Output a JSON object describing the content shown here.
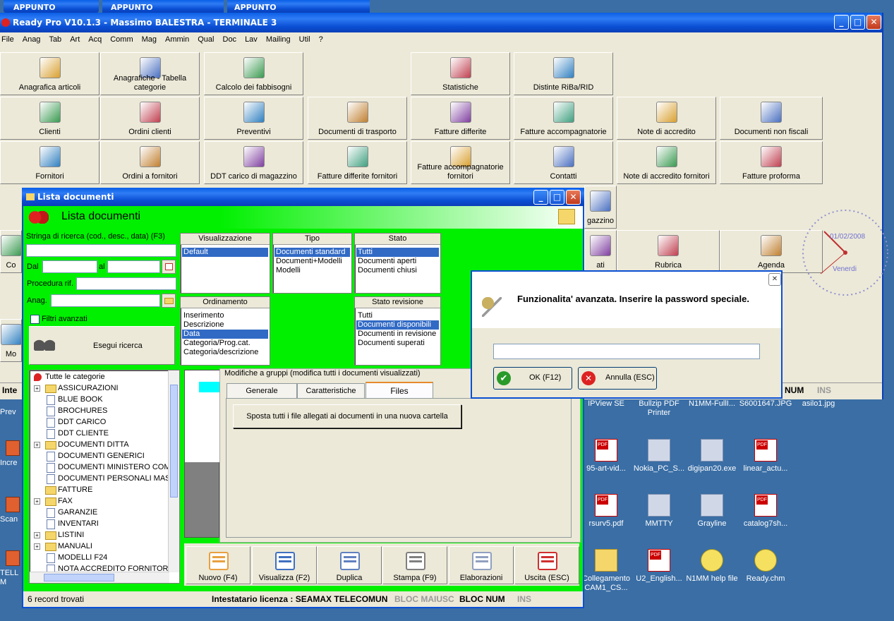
{
  "taskbar": {
    "tabs": [
      "APPUNTO",
      "APPUNTO",
      "APPUNTO"
    ]
  },
  "main_window": {
    "title": "Ready Pro V10.1.3 - Massimo BALESTRA - TERMINALE 3"
  },
  "menu": [
    "File",
    "Anag",
    "Tab",
    "Art",
    "Acq",
    "Comm",
    "Mag",
    "Ammin",
    "Qual",
    "Doc",
    "Lav",
    "Mailing",
    "Util",
    "?"
  ],
  "tiles_row1": [
    "Anagrafica articoli",
    "Anagrafiche - Tabella categorie",
    "Calcolo dei fabbisogni",
    "Statistiche",
    "Distinte RiBa/RID"
  ],
  "tiles_row2": [
    "Clienti",
    "Ordini clienti",
    "Preventivi",
    "Documenti di trasporto",
    "Fatture differite",
    "Fatture accompagnatorie",
    "Note di accredito",
    "Documenti non fiscali"
  ],
  "tiles_row3": [
    "Fornitori",
    "Ordini a fornitori",
    "DDT carico di magazzino",
    "Fatture differite fornitori",
    "Fatture accompagnatorie fornitori",
    "Contatti",
    "Note di accredito fornitori",
    "Fatture proforma"
  ],
  "tiles_partial": {
    "magazzino": "gazzino",
    "rubrica": "Rubrica",
    "agenda": "Agenda",
    "ati": "ati",
    "co": "Co",
    "mo": "Mo",
    "inte": "Inte"
  },
  "clock": {
    "date": "01/02/2008",
    "day": "Venerdi"
  },
  "status_main": {
    "num": "NUM",
    "ins": "INS"
  },
  "lista": {
    "title": "Lista documenti",
    "header": "Lista documenti",
    "search_label": "Stringa di ricerca (cod., desc., data) (F3)",
    "dal": "Dal",
    "al": "al",
    "procedura": "Procedura rif.",
    "anag": "Anag.",
    "filtri": "Filtri avanzati",
    "esegui": "Esegui ricerca",
    "visualizzazione": {
      "title": "Visualizzazione",
      "items": [
        "Default"
      ]
    },
    "tipo": {
      "title": "Tipo",
      "items": [
        "Documenti standard",
        "Documenti+Modelli",
        "Modelli"
      ]
    },
    "stato": {
      "title": "Stato",
      "items": [
        "Tutti",
        "Documenti aperti",
        "Documenti chiusi"
      ]
    },
    "ordinamento": {
      "title": "Ordinamento",
      "items": [
        "Inserimento",
        "Descrizione",
        "Data",
        "Categoria/Prog.cat.",
        "Categoria/descrizione"
      ]
    },
    "stato_revisione": {
      "title": "Stato revisione",
      "items": [
        "Tutti",
        "Documenti disponibili",
        "Documenti in revisione",
        "Documenti superati"
      ]
    },
    "tree": [
      "Tutte le categorie",
      "ASSICURAZIONI",
      "BLUE BOOK",
      "BROCHURES",
      "DDT CARICO",
      "DDT CLIENTE",
      "DOCUMENTI DITTA",
      "DOCUMENTI GENERICI",
      "DOCUMENTI MINISTERO COM",
      "DOCUMENTI PERSONALI MAS",
      "FATTURE",
      "FAX",
      "GARANZIE",
      "INVENTARI",
      "LISTINI",
      "MANUALI",
      "MODELLI F24",
      "NOTA ACCREDITO FORNITOR"
    ],
    "group_title": "Modifiche a gruppi (modifica tutti i documenti visualizzati)",
    "tabs": [
      "Generale",
      "Caratteristiche",
      "Files"
    ],
    "move_btn": "Sposta tutti i file allegati ai documenti in una nuova cartella",
    "toolbar": [
      "Nuovo (F4)",
      "Visualizza (F2)",
      "Duplica",
      "Stampa (F9)",
      "Elaborazioni",
      "Uscita (ESC)"
    ],
    "status": {
      "records": "6 record trovati",
      "license": "Intestatario licenza : SEAMAX TELECOMUN",
      "bloc_maiusc": "BLOC MAIUSC",
      "bloc_num": "BLOC NUM",
      "ins": "INS"
    }
  },
  "dialog": {
    "message": "Funzionalita' avanzata. Inserire la password speciale.",
    "ok": "OK (F12)",
    "cancel": "Annulla (ESC)"
  },
  "desktop_icons": [
    "IPView SE",
    "Bullzip PDF Printer",
    "N1MM-FullI...",
    "S6001647.JPG",
    "asilo1.jpg",
    "95-art-vid...",
    "Nokia_PC_S...",
    "digipan20.exe",
    "linear_actu...",
    "rsurv5.pdf",
    "MMTTY",
    "Grayline",
    "catalog7sh...",
    "Collegamento CAM1_CS...",
    "U2_English...",
    "N1MM help file",
    "Ready.chm"
  ],
  "left_icons": [
    "Prev",
    "Incre",
    "Scan",
    "TELL M"
  ],
  "colors": {
    "green": "#00f000",
    "xp_blue": "#0a5fe6",
    "selection": "#316ac5"
  }
}
